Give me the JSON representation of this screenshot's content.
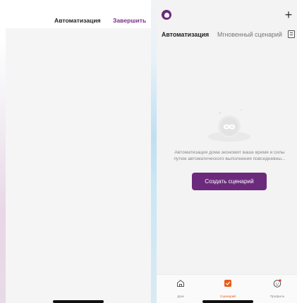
{
  "left_screen": {
    "title": "Автоматизация",
    "done_label": "Завершить"
  },
  "right_screen": {
    "tabs": [
      {
        "label": "Автоматизация",
        "active": true
      },
      {
        "label": "Мгновенный сценарий",
        "active": false
      }
    ],
    "empty_state": {
      "line1": "Автоматизация дома экономит ваше время и силы",
      "line2": "путем автоматического выполнения повседневны..."
    },
    "create_button_label": "Создать сценарий",
    "bottom_nav": [
      {
        "label": "Дом",
        "icon": "home-icon",
        "active": false
      },
      {
        "label": "Сценарий",
        "icon": "scenario-icon",
        "active": true
      },
      {
        "label": "Профиль",
        "icon": "profile-icon",
        "active": false
      }
    ]
  },
  "colors": {
    "accent": "#6c2a7c",
    "active_tab": "#e85d1a",
    "background": "#f3f3f3"
  }
}
